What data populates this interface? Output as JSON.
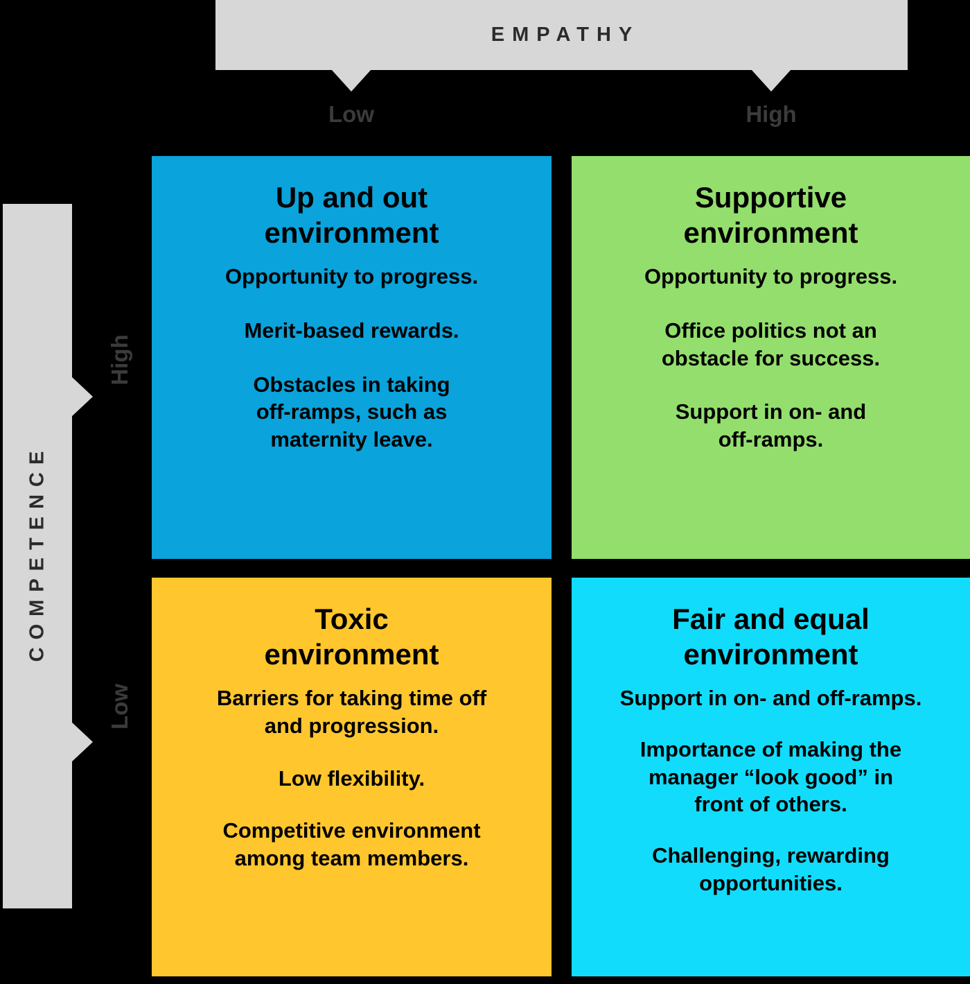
{
  "colors": {
    "background": "#000000",
    "axis_bar": "#d7d7d7",
    "axis_text": "#2b2b2b",
    "tick_text": "#3b3b3b",
    "up_and_out": "#0aa3db",
    "supportive": "#94de6d",
    "toxic": "#ffc62e",
    "fair_and_equal": "#12dcfb"
  },
  "x_axis": {
    "title": "EMPATHY",
    "ticks": [
      {
        "label": "Low"
      },
      {
        "label": "High"
      }
    ]
  },
  "y_axis": {
    "title": "COMPETENCE",
    "ticks": [
      {
        "label": "High"
      },
      {
        "label": "Low"
      }
    ]
  },
  "quadrants": [
    {
      "id": "up-and-out",
      "empathy": "Low",
      "competence": "High",
      "title": "Up and out\nenvironment",
      "points": [
        "Opportunity to progress.",
        "Merit-based rewards.",
        "Obstacles in taking\noff-ramps, such as\nmaternity leave."
      ]
    },
    {
      "id": "supportive",
      "empathy": "High",
      "competence": "High",
      "title": "Supportive\nenvironment",
      "points": [
        "Opportunity to progress.",
        "Office politics not an\nobstacle for success.",
        "Support in on- and\noff-ramps."
      ]
    },
    {
      "id": "toxic",
      "empathy": "Low",
      "competence": "Low",
      "title": "Toxic\nenvironment",
      "points": [
        "Barriers for taking time off\nand progression.",
        "Low flexibility.",
        "Competitive environment\namong team members."
      ]
    },
    {
      "id": "fair-and-equal",
      "empathy": "High",
      "competence": "Low",
      "title": "Fair and equal\nenvironment",
      "points": [
        "Support in on- and off-ramps.",
        "Importance of making the\nmanager “look good” in\nfront of others.",
        "Challenging, rewarding\nopportunities."
      ]
    }
  ]
}
